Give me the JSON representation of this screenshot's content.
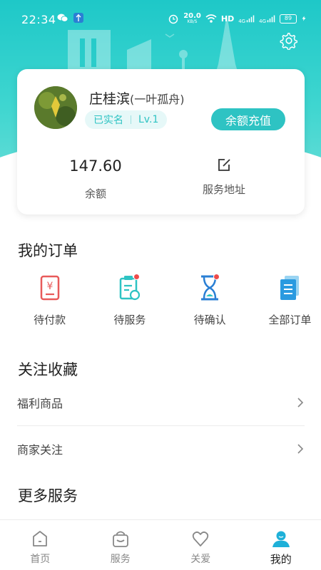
{
  "status_bar": {
    "time": "22:34",
    "net_speed": "20.0",
    "net_unit": "KB/S",
    "hd": "HD",
    "sig1": "4G",
    "sig2": "4G",
    "battery": "89"
  },
  "profile": {
    "name": "庄桂滨",
    "nickname": "(一叶孤舟)",
    "verified_tag": "已实名",
    "level_tag": "Lv.1",
    "recharge_button": "余额充值",
    "balance_value": "147.60",
    "balance_label": "余额",
    "address_label": "服务地址"
  },
  "orders": {
    "title": "我的订单",
    "items": [
      {
        "label": "待付款",
        "icon": "payment-icon"
      },
      {
        "label": "待服务",
        "icon": "clipboard-icon"
      },
      {
        "label": "待确认",
        "icon": "hourglass-icon"
      },
      {
        "label": "全部订单",
        "icon": "document-list-icon"
      }
    ]
  },
  "favorites": {
    "title": "关注收藏",
    "rows": [
      {
        "label": "福利商品"
      },
      {
        "label": "商家关注"
      }
    ]
  },
  "more_services": {
    "title": "更多服务"
  },
  "bottom_nav": {
    "items": [
      {
        "label": "首页",
        "icon": "home-icon"
      },
      {
        "label": "服务",
        "icon": "shopping-bag-icon"
      },
      {
        "label": "关爱",
        "icon": "heart-icon"
      },
      {
        "label": "我的",
        "icon": "user-icon",
        "active": true
      }
    ]
  },
  "colors": {
    "accent": "#2ec3c3",
    "header_gradient_top": "#1ec8c8",
    "badge_red": "#ee4b4b",
    "payment_red": "#e85a5a"
  }
}
